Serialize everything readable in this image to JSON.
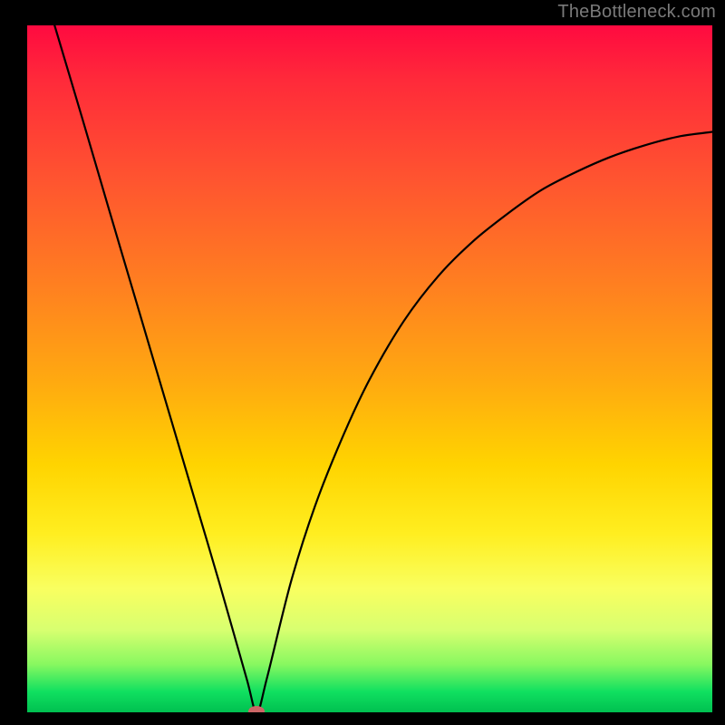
{
  "watermark": "TheBottleneck.com",
  "chart_data": {
    "type": "line",
    "title": "",
    "xlabel": "",
    "ylabel": "",
    "xlim": [
      0,
      100
    ],
    "ylim": [
      0,
      100
    ],
    "grid": false,
    "legend": false,
    "series": [
      {
        "name": "bottleneck-curve",
        "x": [
          4.0,
          8.0,
          12.0,
          16.0,
          20.0,
          24.0,
          28.0,
          32.0,
          33.5,
          35.0,
          38.5,
          42.0,
          46.0,
          50.0,
          55.0,
          60.0,
          65.0,
          70.0,
          75.0,
          80.0,
          85.0,
          90.0,
          95.0,
          100.0
        ],
        "y": [
          100.0,
          86.6,
          73.0,
          59.5,
          46.0,
          32.5,
          19.0,
          5.0,
          0.0,
          5.0,
          19.0,
          30.0,
          40.0,
          48.5,
          57.0,
          63.5,
          68.5,
          72.5,
          76.0,
          78.6,
          80.8,
          82.5,
          83.8,
          84.5
        ]
      }
    ],
    "marker": {
      "x": 33.5,
      "y": 0
    },
    "background_gradient": {
      "stops": [
        {
          "pos": 0,
          "color": "#ff0a40"
        },
        {
          "pos": 50,
          "color": "#ffaa10"
        },
        {
          "pos": 75,
          "color": "#ffee20"
        },
        {
          "pos": 100,
          "color": "#00c050"
        }
      ]
    }
  }
}
